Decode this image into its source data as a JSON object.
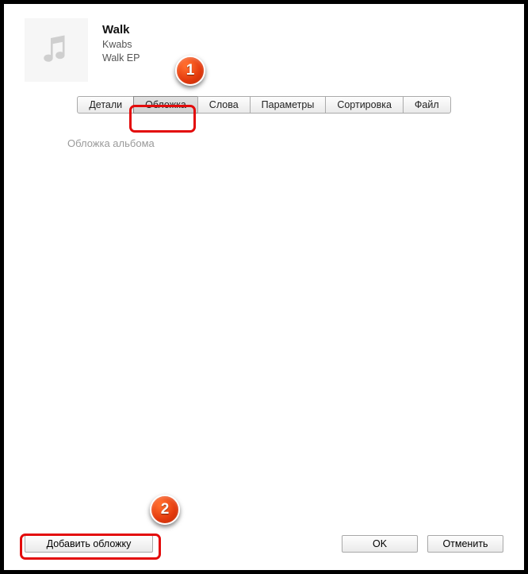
{
  "track": {
    "title": "Walk",
    "artist": "Kwabs",
    "album": "Walk EP"
  },
  "tabs": {
    "details": "Детали",
    "artwork": "Обложка",
    "lyrics": "Слова",
    "options": "Параметры",
    "sorting": "Сортировка",
    "file": "Файл"
  },
  "content": {
    "artwork_label": "Обложка альбома"
  },
  "buttons": {
    "add_artwork": "Добавить обложку",
    "ok": "OK",
    "cancel": "Отменить"
  },
  "callouts": {
    "one": "1",
    "two": "2"
  }
}
